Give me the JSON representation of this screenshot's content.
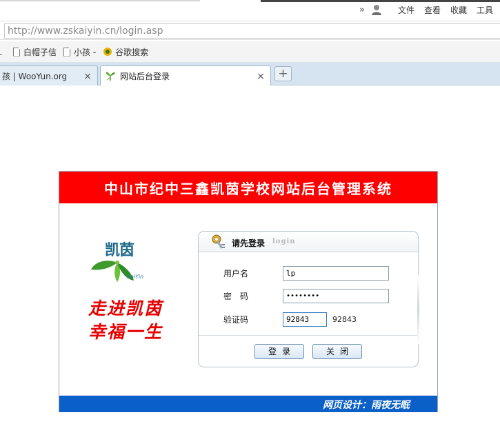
{
  "browser": {
    "menu": {
      "more": "»",
      "items": [
        "文件",
        "查看",
        "收藏",
        "工具"
      ]
    },
    "address": "http://www.zskaiyin.cn/login.asp",
    "favorites": [
      "白帽子信",
      "小孩 -",
      "谷歌搜索"
    ],
    "tabs": [
      {
        "title": "孩 | WooYun.org",
        "close": "×"
      },
      {
        "title": "网站后台登录",
        "close": "×"
      }
    ],
    "new_tab": "+"
  },
  "page": {
    "system_title": "中山市纪中三鑫凯茵学校网站后台管理系统",
    "logo_name": "凯茵",
    "logo_en": "KaiYin",
    "slogan_line1": "走进凯茵",
    "slogan_line2": "幸福一生",
    "login": {
      "title": "请先登录",
      "title_en": "login",
      "username_label": "用户名",
      "username_value": "lp",
      "password_label": "密　码",
      "password_value": "••••••••",
      "code_label": "验证码",
      "code_value": "92843",
      "captcha_text": "92843",
      "login_button": "登录",
      "close_button": "关闭"
    },
    "footer_credit": "网页设计：雨夜无眠"
  },
  "colors": {
    "header_band": "#ff0000",
    "footer_band": "#0a5fc8",
    "slogan": "#e60000",
    "tab_bar": "#d5e4f0"
  }
}
